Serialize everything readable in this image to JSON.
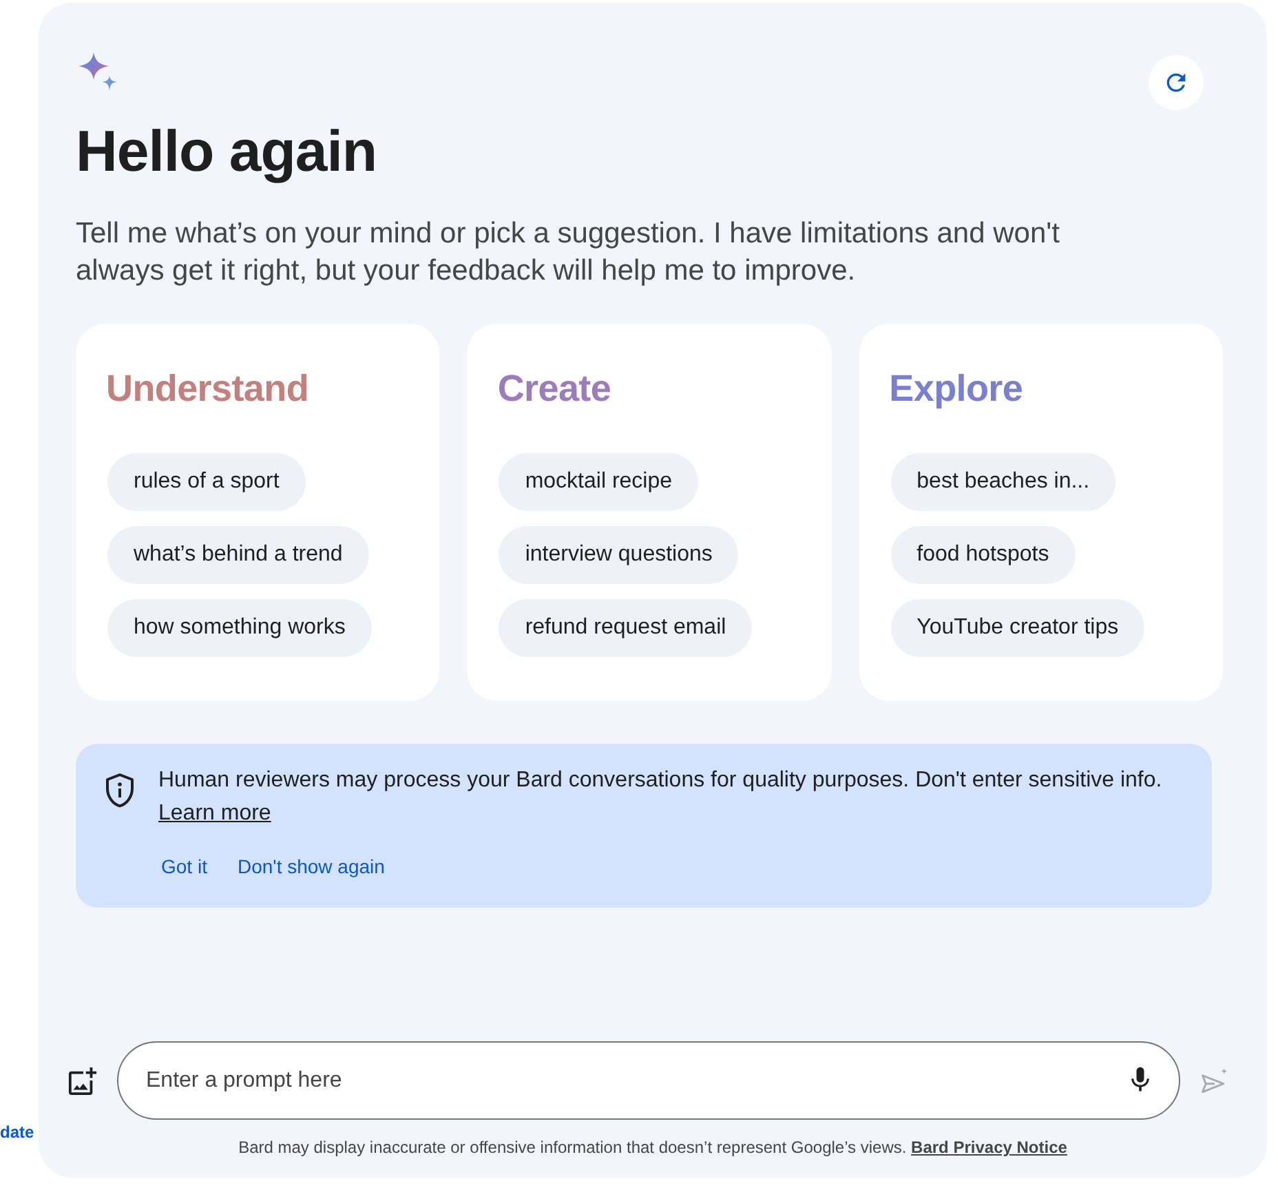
{
  "side_link": {
    "label": "date"
  },
  "header": {
    "title": "Hello again",
    "subtitle": "Tell me what’s on your mind or pick a suggestion. I have limitations and won't always get it right, but your feedback will help me to improve."
  },
  "categories": [
    {
      "title": "Understand",
      "color": "#c4807f",
      "suggestions": [
        "rules of a sport",
        "what’s behind a trend",
        "how something works"
      ]
    },
    {
      "title": "Create",
      "color": "#9c7cbb",
      "suggestions": [
        "mocktail recipe",
        "interview questions",
        "refund request email"
      ]
    },
    {
      "title": "Explore",
      "color": "#7a80cf",
      "suggestions": [
        "best beaches in...",
        "food hotspots",
        "YouTube creator tips"
      ]
    }
  ],
  "notice": {
    "text": "Human reviewers may process your Bard conversations for quality purposes. Don't enter sensitive info.",
    "link": "Learn more",
    "actions": [
      "Got it",
      "Don't show again"
    ]
  },
  "prompt": {
    "placeholder": "Enter a prompt here",
    "send_disabled": true
  },
  "disclaimer": {
    "text": "Bard may display inaccurate or offensive information that doesn’t represent Google’s views.",
    "link": "Bard Privacy Notice"
  }
}
